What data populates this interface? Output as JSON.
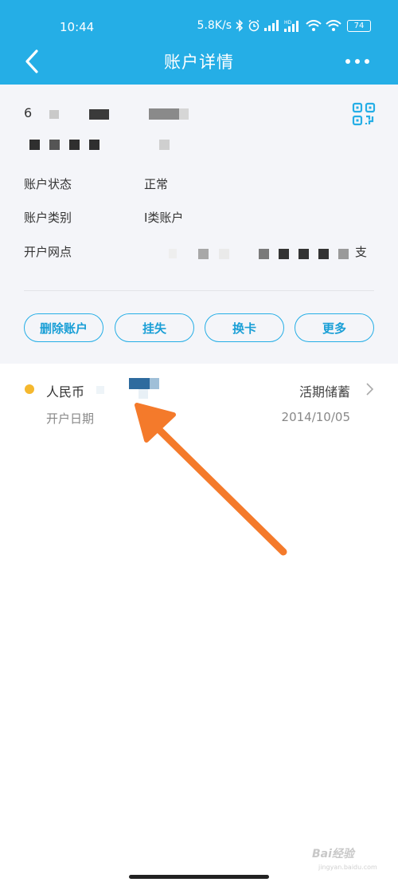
{
  "status_bar": {
    "time": "10:44",
    "network_speed": "5.8K/s",
    "battery_level": "74",
    "icons": [
      "bluetooth-icon",
      "alarm-icon",
      "signal-icon",
      "hd-signal-icon",
      "wifi-icon",
      "wifi-icon",
      "battery-icon"
    ]
  },
  "nav": {
    "title": "账户详情",
    "back_icon": "chevron-left-icon",
    "more_icon": "more-dots-icon"
  },
  "account": {
    "number_prefix": "6",
    "qr_icon": "qr-code-icon",
    "fields": [
      {
        "label": "账户状态",
        "value": "正常"
      },
      {
        "label": "账户类别",
        "value": "I类账户"
      },
      {
        "label": "开户网点",
        "value": "支"
      }
    ]
  },
  "actions": {
    "delete": "删除账户",
    "report_loss": "挂失",
    "replace_card": "换卡",
    "more": "更多"
  },
  "subaccount": {
    "currency": "人民币",
    "type": "活期储蓄",
    "open_date_label": "开户日期",
    "open_date": "2014/10/05"
  },
  "watermark": {
    "text": "Bai经验",
    "url": "jingyan.baidu.com"
  },
  "colors": {
    "header": "#25aee6",
    "accent": "#1a9fd6",
    "card_bg": "#f4f5f9",
    "dot": "#f5b82e",
    "arrow": "#f47a2b"
  }
}
